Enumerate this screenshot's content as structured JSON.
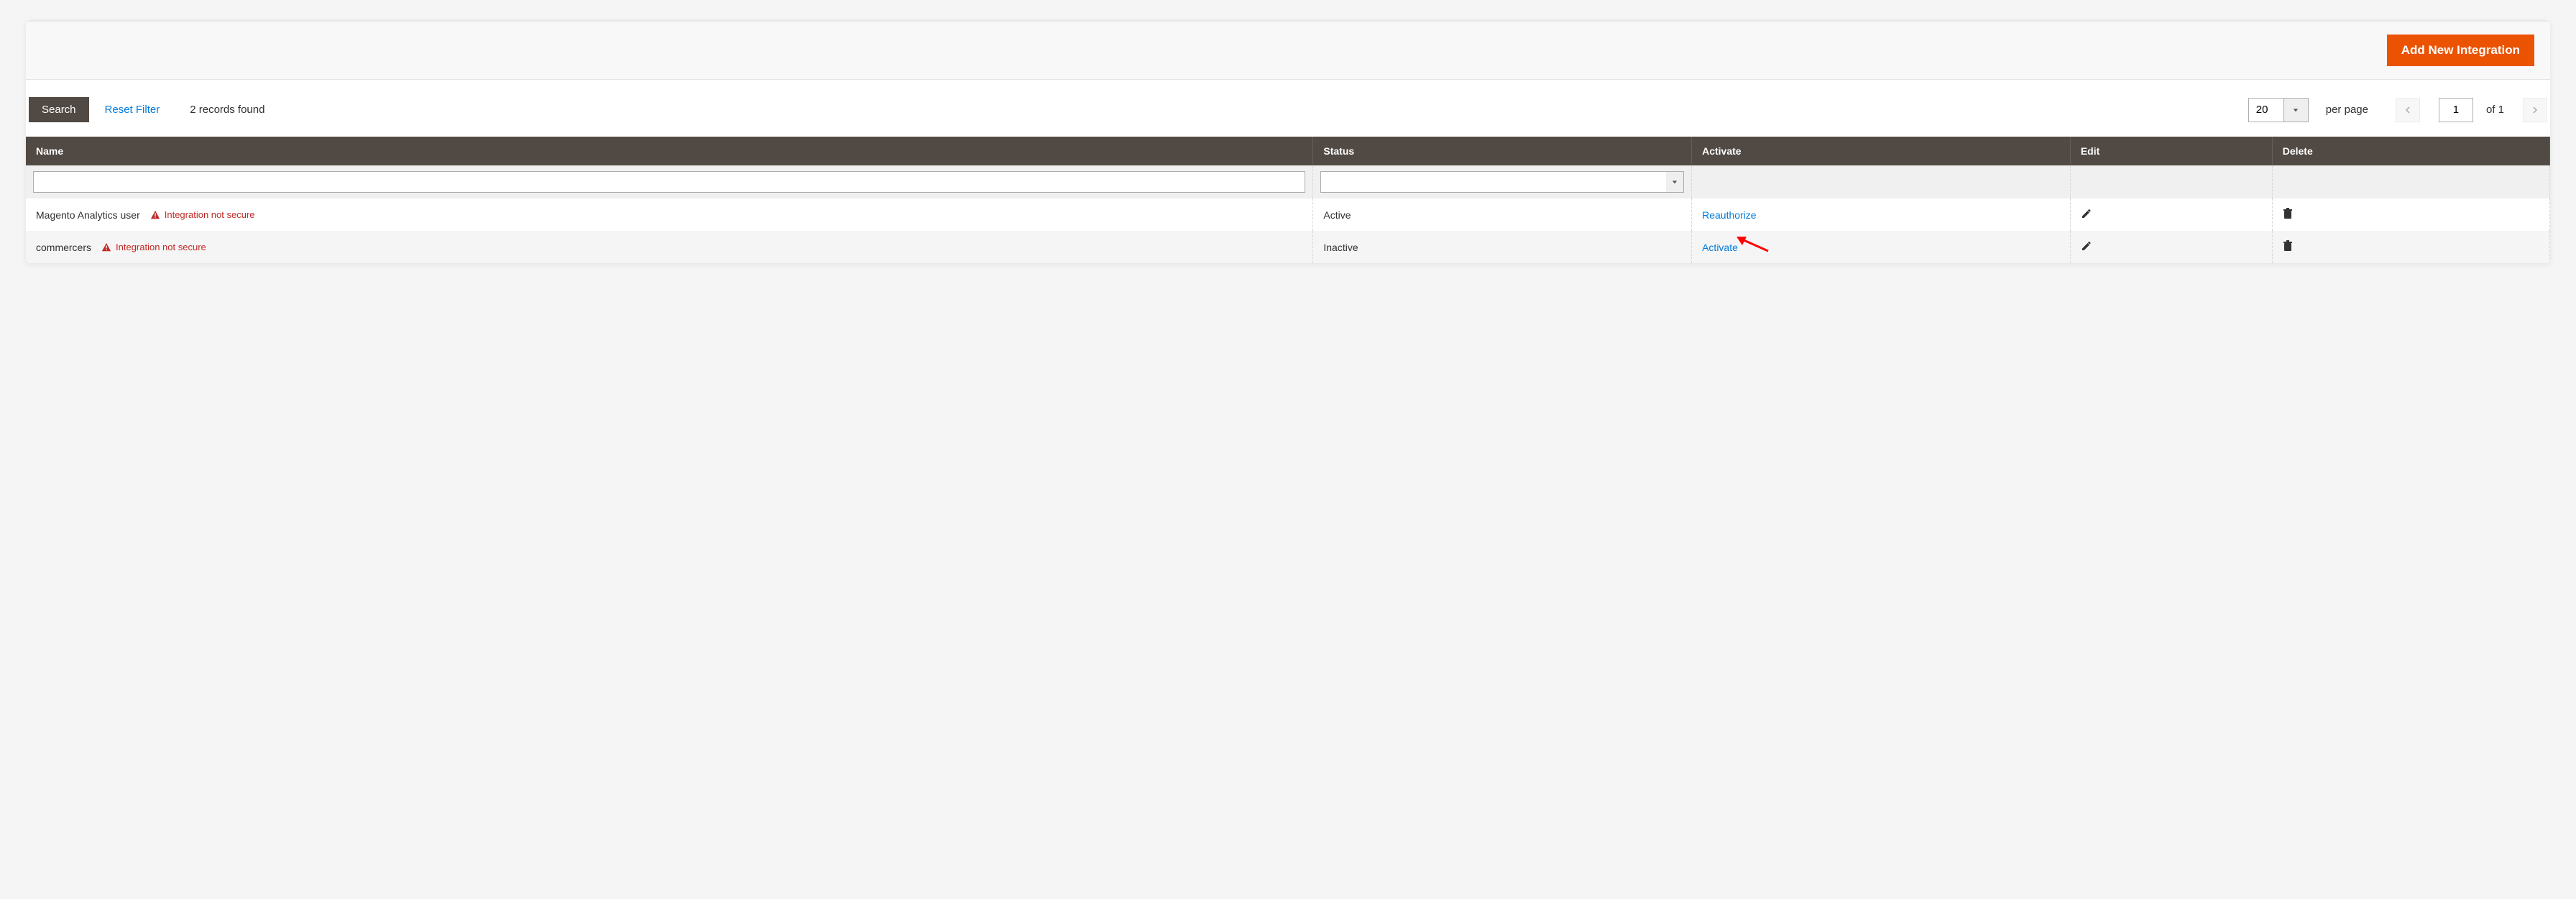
{
  "toolbar": {
    "add_button": "Add New Integration",
    "search_button": "Search",
    "reset_filter": "Reset Filter",
    "records_found": "2 records found",
    "page_size": "20",
    "per_page": "per page",
    "current_page": "1",
    "total_pages_label": "of 1"
  },
  "table": {
    "headers": {
      "name": "Name",
      "status": "Status",
      "activate": "Activate",
      "edit": "Edit",
      "delete": "Delete"
    },
    "filters": {
      "name": "",
      "status": ""
    },
    "rows": [
      {
        "name": "Magento Analytics user",
        "warning": "Integration not secure",
        "status": "Active",
        "action_label": "Reauthorize"
      },
      {
        "name": "commercers",
        "warning": "Integration not secure",
        "status": "Inactive",
        "action_label": "Activate"
      }
    ]
  }
}
